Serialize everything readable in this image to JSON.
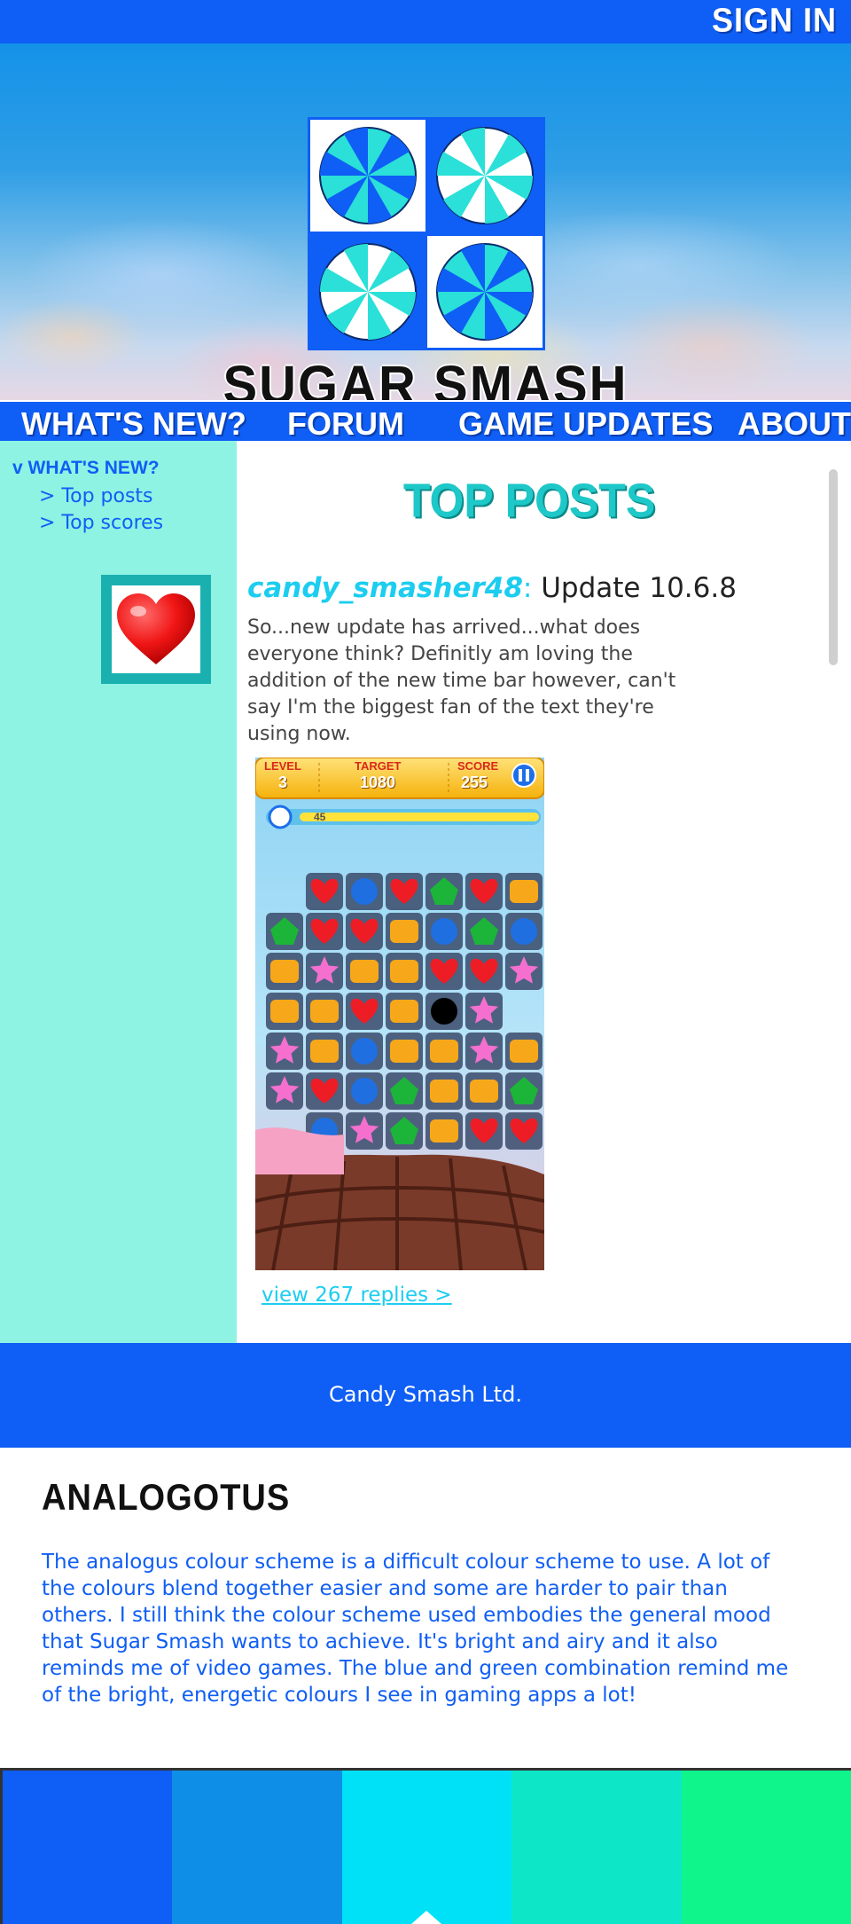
{
  "header": {
    "sign_in": "SIGN IN",
    "site_title": "SUGAR SMASH"
  },
  "nav": {
    "items": [
      {
        "label": "WHAT'S NEW?"
      },
      {
        "label": "FORUM"
      },
      {
        "label": "GAME UPDATES"
      },
      {
        "label": "ABOUT"
      }
    ]
  },
  "sidebar": {
    "section": "v WHAT'S NEW?",
    "links": [
      "> Top posts",
      "> Top scores"
    ],
    "avatar_icon": "heart-icon"
  },
  "main": {
    "title": "TOP POSTS",
    "post": {
      "username": "candy_smasher48",
      "separator": ":",
      "subject": " Update 10.6.8",
      "body": "So...new update has arrived...what does everyone think? Definitly am loving the addition of the new time bar however, can't say I'm the biggest fan of the text they're using now.",
      "screenshot": {
        "level_label": "LEVEL",
        "level_value": "3",
        "target_label": "TARGET",
        "target_value": "1080",
        "score_label": "SCORE",
        "score_value": "255",
        "timer": "45"
      },
      "replies_link": "view 267 replies >"
    }
  },
  "footer": {
    "text": "Candy Smash Ltd."
  },
  "analogous": {
    "title": "ANALOGOTUS",
    "body": "The analogus colour scheme is a difficult colour scheme to use. A lot of the colours blend together easier and some are harder to pair than others. I still think the colour scheme used embodies the general mood that Sugar Smash wants to achieve. It's bright and airy and it also reminds me of video games. The blue and green combination remind me of the bright, energetic colours I see in gaming apps a lot!"
  },
  "palette": {
    "colors": [
      "#0f5ef5",
      "#0f8ee8",
      "#00e1f8",
      "#0ee6c8",
      "#0ff58c"
    ]
  },
  "colors": {
    "primary_blue": "#0f5ef5",
    "sidebar_mint": "#8ef3e2",
    "accent_cyan": "#1ccdf0",
    "title_teal": "#1ec8c8"
  }
}
